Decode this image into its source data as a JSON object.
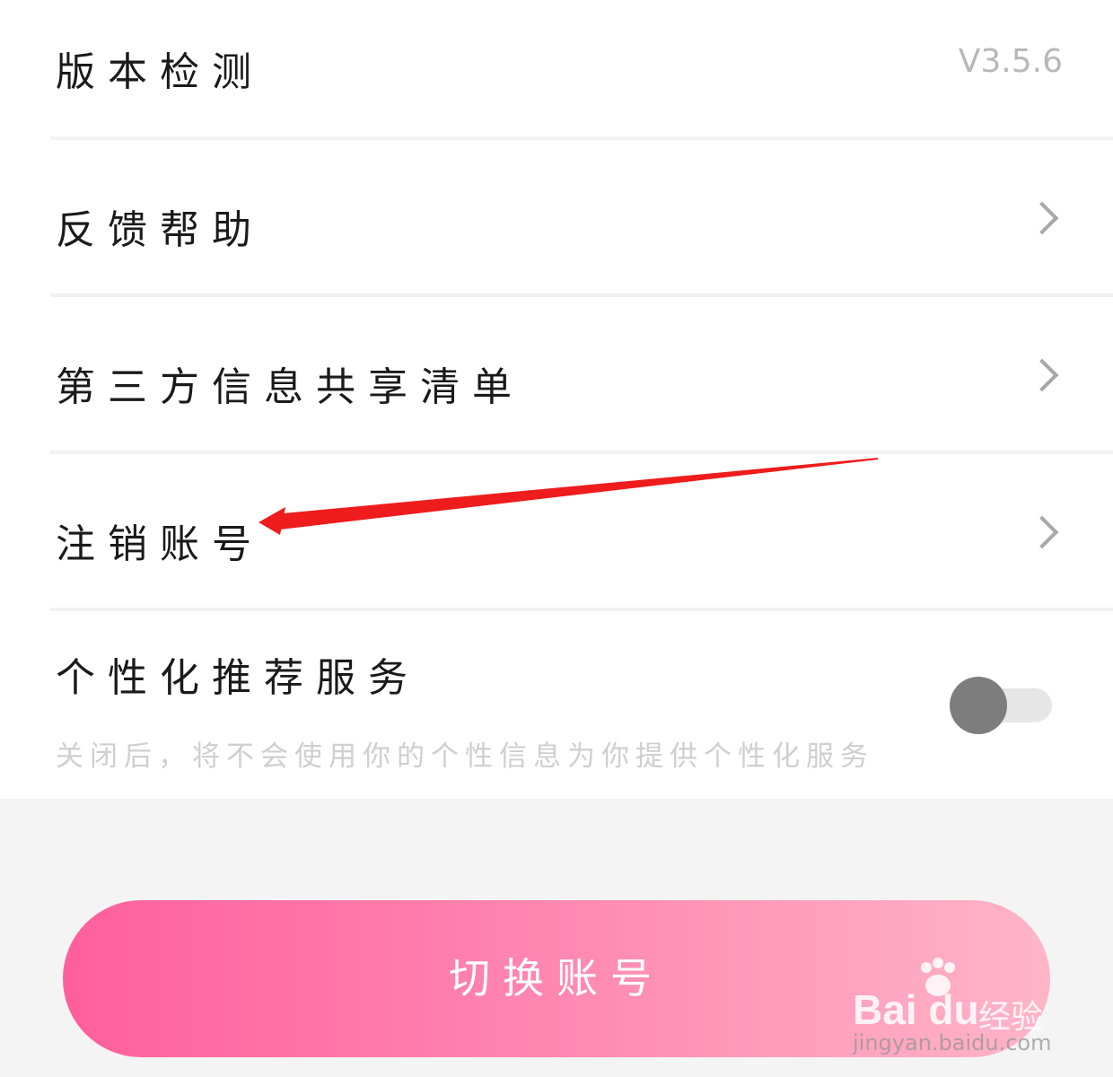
{
  "settings": {
    "version_check": {
      "label": "版本检测",
      "value": "V3.5.6"
    },
    "feedback": {
      "label": "反馈帮助"
    },
    "third_party": {
      "label": "第三方信息共享清单"
    },
    "deactivate": {
      "label": "注销账号"
    },
    "personalization": {
      "label": "个性化推荐服务",
      "description": "关闭后，将不会使用你的个性信息为你提供个性化服务",
      "enabled": false
    }
  },
  "footer": {
    "switch_account_label": "切换账号"
  },
  "watermark": {
    "brand": "Bai du",
    "sub": "经验",
    "url": "jingyan.baidu.com"
  },
  "colors": {
    "button_gradient_start": "#ff5f9c",
    "button_gradient_end": "#ffb5c9",
    "annotation_arrow": "#ee1c1c"
  },
  "icons": [
    "chevron-right-icon",
    "baidu-paw-icon"
  ]
}
